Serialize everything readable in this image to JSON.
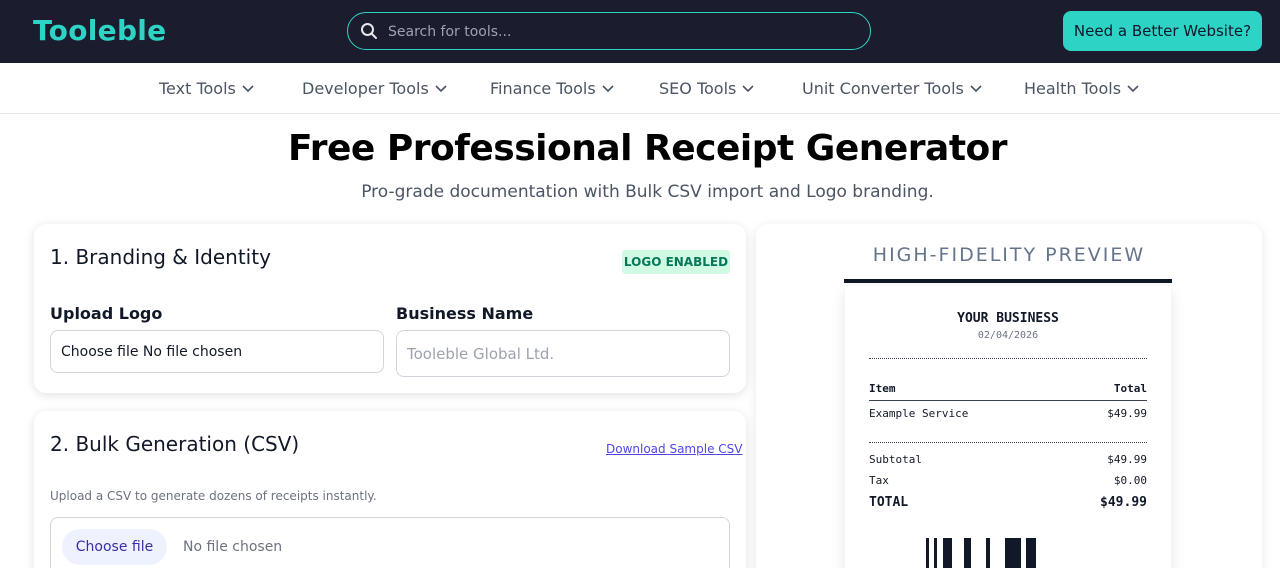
{
  "header": {
    "logo": "Tooleble",
    "search_placeholder": "Search for tools...",
    "cta_label": "Need a Better Website?",
    "colors": {
      "bar": "#1b1c2e",
      "accent": "#2dd4c6"
    }
  },
  "nav": {
    "items": [
      {
        "label": "Text Tools"
      },
      {
        "label": "Developer Tools"
      },
      {
        "label": "Finance Tools"
      },
      {
        "label": "SEO Tools"
      },
      {
        "label": "Unit Converter Tools"
      },
      {
        "label": "Health Tools"
      }
    ]
  },
  "page": {
    "title": "Free Professional Receipt Generator",
    "subtitle": "Pro-grade documentation with Bulk CSV import and Logo branding."
  },
  "branding": {
    "title": "1. Branding & Identity",
    "badge": "LOGO ENABLED",
    "upload_label": "Upload Logo",
    "upload_value": "Choose file No file chosen",
    "business_label": "Business Name",
    "business_placeholder": "Tooleble Global Ltd."
  },
  "bulk": {
    "title": "2. Bulk Generation (CSV)",
    "sample_link": "Download Sample CSV",
    "hint": "Upload a CSV to generate dozens of receipts instantly.",
    "choose_label": "Choose file",
    "no_file": "No file chosen"
  },
  "preview": {
    "title": "HIGH-FIDELITY PREVIEW",
    "business": "YOUR BUSINESS",
    "date": "02/04/2026",
    "col_item": "Item",
    "col_total": "Total",
    "line_item": "Example Service",
    "line_amount": "$49.99",
    "subtotal_label": "Subtotal",
    "subtotal_value": "$49.99",
    "tax_label": "Tax",
    "tax_value": "$0.00",
    "total_label": "TOTAL",
    "total_value": "$49.99"
  }
}
